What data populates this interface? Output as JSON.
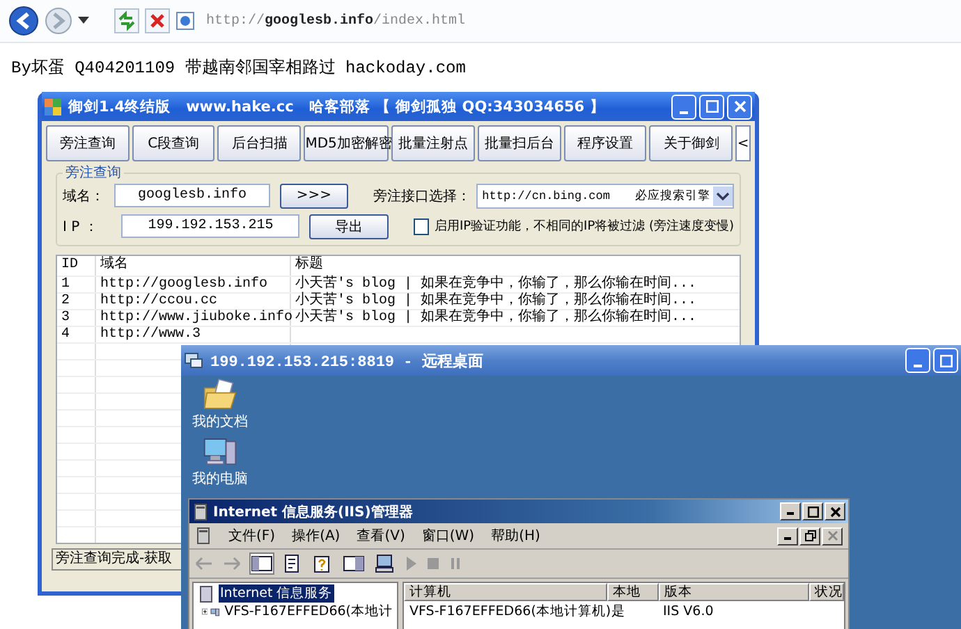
{
  "browser": {
    "url": "http://**googlesb.info**/index.html"
  },
  "page_text": "By坏蛋 Q404201109 带越南邻国宰相路过 hackoday.com",
  "tool_window": {
    "title": "御剑1.4终结版　www.hake.cc　哈客部落 【 御剑孤独 QQ:343034656 】",
    "buttons": [
      "旁注查询",
      "C段查询",
      "后台扫描",
      "MD5加密解密",
      "批量注射点",
      "批量扫后台",
      "程序设置",
      "关于御剑"
    ],
    "scroll_button": "<",
    "group": {
      "title": "旁注查询",
      "domain_label": "域名：",
      "domain_value": "googlesb.info",
      "go_button": ">>>",
      "ip_label": "I P ：",
      "ip_value": "199.192.153.215",
      "export_button": "导出",
      "api_label": "旁注接口选择：",
      "api_value": "http://cn.bing.com　　必应搜索引擎",
      "ip_check": {
        "label": "启用IP验证功能，不相同的IP将被过滤 (旁注速度变慢)",
        "checked": false
      }
    },
    "table": {
      "columns": [
        "ID",
        "域名",
        "标题"
      ],
      "rows": [
        {
          "id": "1",
          "domain": "http://googlesb.info",
          "title": "小天苦's blog | 如果在竞争中，你输了，那么你输在时间..."
        },
        {
          "id": "2",
          "domain": "http://ccou.cc",
          "title": "小天苦's blog | 如果在竞争中，你输了，那么你输在时间..."
        },
        {
          "id": "3",
          "domain": "http://www.jiuboke.info",
          "title": "小天苦's blog | 如果在竞争中，你输了，那么你输在时间..."
        },
        {
          "id": "4",
          "domain": "http://www.3"
        }
      ]
    },
    "status": "旁注查询完成-获取"
  },
  "remote_desktop": {
    "title": "199.192.153.215:8819 - 远程桌面",
    "icons": [
      {
        "label": "我的文档",
        "kind": "documents"
      },
      {
        "label": "我的电脑",
        "kind": "computer"
      }
    ]
  },
  "iis_window": {
    "title": "Internet 信息服务(IIS)管理器",
    "menu": [
      "文件(F)",
      "操作(A)",
      "查看(V)",
      "窗口(W)",
      "帮助(H)"
    ],
    "tree": [
      {
        "label": "Internet 信息服务",
        "selected": true,
        "children": [
          {
            "label": "VFS-F167EFFED66(本地计",
            "selected": false
          }
        ]
      }
    ],
    "list": {
      "columns": [
        "计算机",
        "本地",
        "版本",
        "状况"
      ],
      "rows": [
        [
          "VFS-F167EFFED66(本地计算机)",
          "是",
          "IIS V6.0"
        ]
      ]
    }
  }
}
